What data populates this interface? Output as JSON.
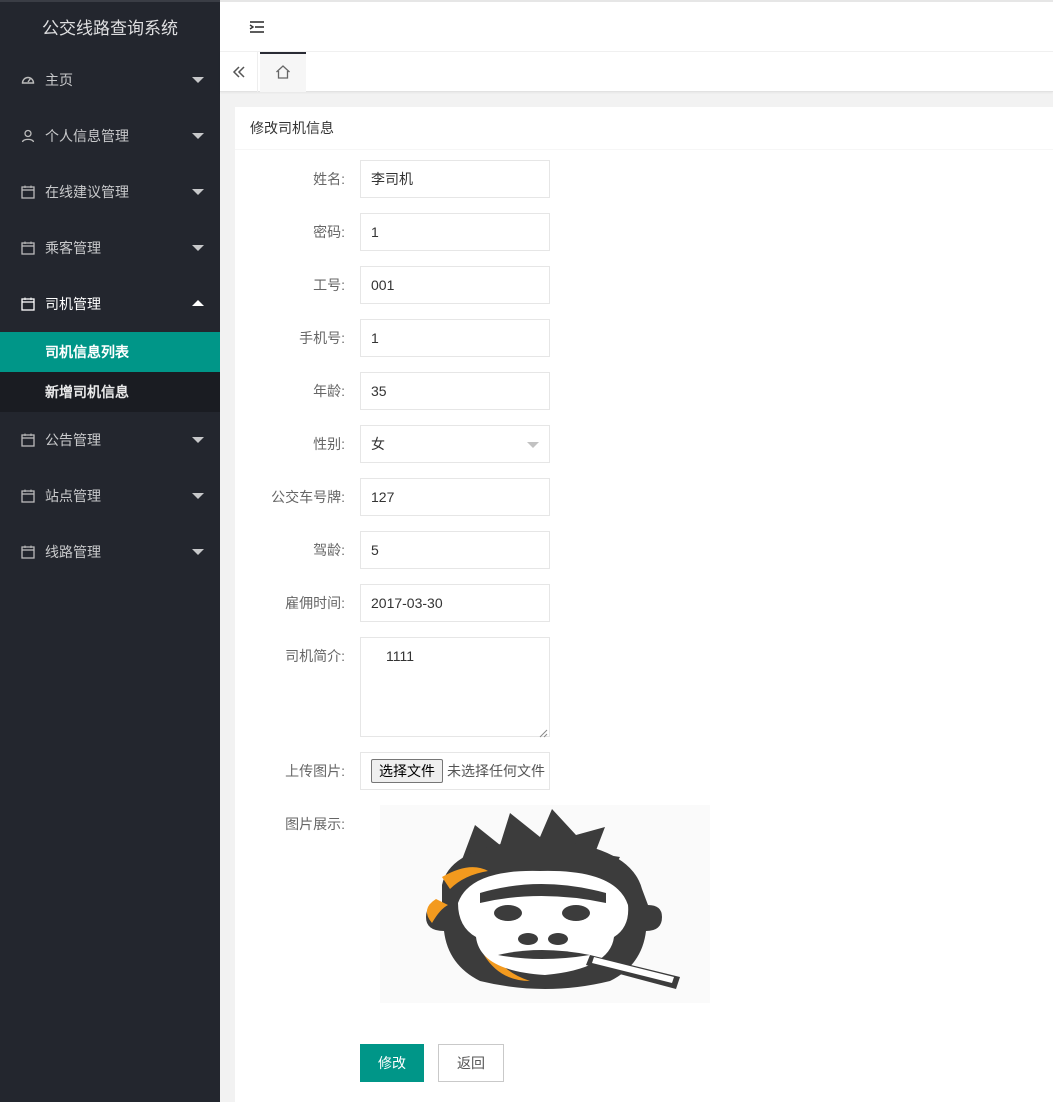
{
  "app": {
    "title": "公交线路查询系统"
  },
  "sidebar": {
    "items": [
      {
        "label": "主页",
        "icon": "dashboard-icon"
      },
      {
        "label": "个人信息管理",
        "icon": "user-icon"
      },
      {
        "label": "在线建议管理",
        "icon": "calendar-icon"
      },
      {
        "label": "乘客管理",
        "icon": "calendar-icon"
      },
      {
        "label": "司机管理",
        "icon": "calendar-icon",
        "open": true,
        "children": [
          {
            "label": "司机信息列表",
            "active": true
          },
          {
            "label": "新增司机信息",
            "active": false
          }
        ]
      },
      {
        "label": "公告管理",
        "icon": "calendar-icon"
      },
      {
        "label": "站点管理",
        "icon": "calendar-icon"
      },
      {
        "label": "线路管理",
        "icon": "calendar-icon"
      }
    ]
  },
  "card": {
    "title": "修改司机信息"
  },
  "form": {
    "name": {
      "label": "姓名:",
      "value": "李司机"
    },
    "password": {
      "label": "密码:",
      "value": "1"
    },
    "job_no": {
      "label": "工号:",
      "value": "001"
    },
    "phone": {
      "label": "手机号:",
      "value": "1"
    },
    "age": {
      "label": "年龄:",
      "value": "35"
    },
    "gender": {
      "label": "性别:",
      "value": "女"
    },
    "bus_plate": {
      "label": "公交车号牌:",
      "value": "127"
    },
    "drive_age": {
      "label": "驾龄:",
      "value": "5"
    },
    "hire_date": {
      "label": "雇佣时间:",
      "value": "2017-03-30"
    },
    "intro": {
      "label": "司机简介:",
      "value": "1111"
    },
    "upload": {
      "label": "上传图片:",
      "button": "选择文件",
      "status": "未选择任何文件"
    },
    "preview": {
      "label": "图片展示:"
    }
  },
  "actions": {
    "submit": "修改",
    "back": "返回"
  },
  "colors": {
    "accent": "#009688",
    "sidebar_bg": "#23262e",
    "submenu_bg": "#1a1c22"
  }
}
